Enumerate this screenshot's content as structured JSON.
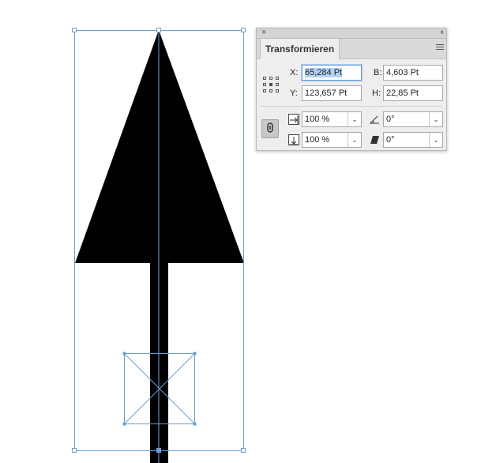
{
  "panel": {
    "close_symbol": "×",
    "collapse_symbol": "‹‹",
    "tab_label": "Transformieren",
    "x_label": "X:",
    "x_value_selected": "65,284 Pt",
    "y_label": "Y:",
    "y_value": "123,657 Pt",
    "w_label": "B:",
    "w_value": "4,603 Pt",
    "h_label": "H:",
    "h_value": "22,85 Pt",
    "scale_x_value": "100 %",
    "scale_y_value": "100 %",
    "rotation_value": "0°",
    "shear_value": "0°",
    "dropdown_arrow": "⌄",
    "link_symbol": "🔗"
  },
  "canvas": {
    "selection_color": "#6b9fd4",
    "shape_color": "#000000",
    "background": "#ffffff"
  }
}
